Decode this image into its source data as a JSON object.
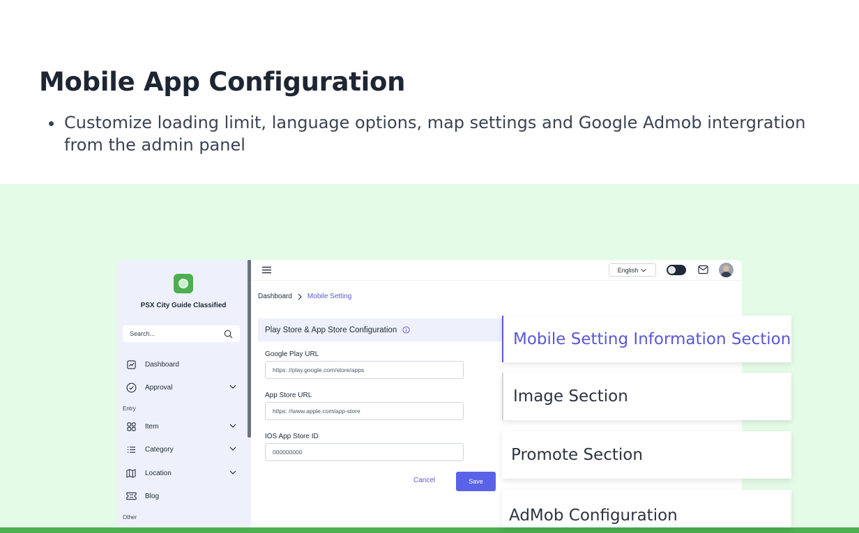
{
  "heading": "Mobile App Configuration",
  "bullets": [
    "Customize loading limit, language options, map settings and Google Admob intergration from the admin panel"
  ],
  "sidebar": {
    "app_name": "PSX City Guide Classified",
    "search_placeholder": "Search...",
    "items": [
      {
        "label": "Dashboard",
        "icon": "chart-icon"
      },
      {
        "label": "Approval",
        "icon": "check-circle-icon"
      },
      {
        "label": "Item",
        "icon": "grid-icon"
      },
      {
        "label": "Category",
        "icon": "list-icon"
      },
      {
        "label": "Location",
        "icon": "map-icon"
      },
      {
        "label": "Blog",
        "icon": "ticket-icon"
      }
    ],
    "groups": [
      "Entry",
      "Other"
    ]
  },
  "topbar": {
    "language": "English"
  },
  "breadcrumb": {
    "root": "Dashboard",
    "current": "Mobile Setting"
  },
  "form": {
    "section_title": "Play Store & App Store Configuration",
    "fields": [
      {
        "label": "Google Play URL",
        "value": "https: //play.google.com/store/apps"
      },
      {
        "label": "App Store URL",
        "value": "https: //www.apple.com/app-store"
      },
      {
        "label": "IOS App Store ID",
        "value": "000000000"
      }
    ],
    "cancel_label": "Cancel",
    "save_label": "Save"
  },
  "cards": [
    "Mobile Setting Information Section",
    "Image  Section",
    "Promote Section",
    "AdMob Configuration"
  ],
  "colors": {
    "accent": "#5a57d6",
    "band": "#e4fbe7",
    "brand_green": "#4caf50"
  }
}
